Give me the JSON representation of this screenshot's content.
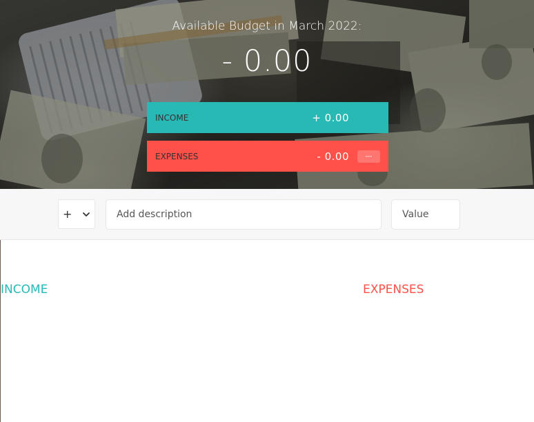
{
  "header": {
    "title": "Available Budget in March 2022:",
    "budget_value": "- 0.00"
  },
  "summary": {
    "income": {
      "label": "Income",
      "value": "+ 0.00",
      "color": "#28b9b5"
    },
    "expenses": {
      "label": "Expenses",
      "value": "- 0.00",
      "percentage": "---",
      "color": "#ff5049"
    }
  },
  "add": {
    "type_selected": "+",
    "description_placeholder": "Add description",
    "value_placeholder": "Value",
    "type_icon": "chevron-down-icon"
  },
  "lists": {
    "income_title": "Income",
    "expenses_title": "Expenses"
  }
}
